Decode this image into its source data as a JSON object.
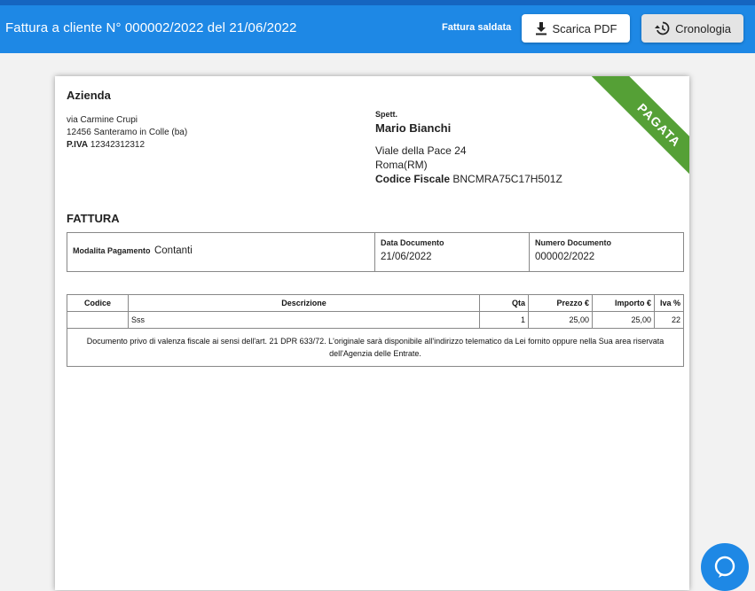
{
  "header": {
    "title": "Fattura a cliente N° 000002/2022 del 21/06/2022",
    "status": "Fattura saldata",
    "pdf_label": "Scarica PDF",
    "history_label": "Cronologia"
  },
  "invoice": {
    "stamp": "PAGATA",
    "company": {
      "name": "Azienda",
      "address1": "via Carmine Crupi",
      "address2": "12456 Santeramo in Colle (ba)",
      "piva_label": "P.IVA",
      "piva": "12342312312"
    },
    "client": {
      "prefix": "Spett.",
      "name": "Mario Bianchi",
      "address1": "Viale della Pace 24",
      "address2": "Roma(RM)",
      "cf_label": "Codice Fiscale",
      "cf": "BNCMRA75C17H501Z"
    },
    "doc_title": "FATTURA",
    "payment_label": "Modalita Pagamento",
    "payment_value": "Contanti",
    "date_label": "Data Documento",
    "date_value": "21/06/2022",
    "number_label": "Numero Documento",
    "number_value": "000002/2022",
    "table": {
      "headers": [
        "Codice",
        "Descrizione",
        "Qta",
        "Prezzo €",
        "Importo €",
        "Iva %"
      ],
      "rows": [
        [
          "",
          "Sss",
          "1",
          "25,00",
          "25,00",
          "22"
        ]
      ],
      "note": "Documento privo di valenza fiscale ai sensi dell'art. 21 DPR 633/72. L'originale sarà disponibile all'indirizzo telematico da Lei fornito oppure nella Sua area riservata dell'Agenzia delle Entrate."
    }
  },
  "icons": {
    "download": "download-icon",
    "history": "history-icon",
    "chat": "chat-icon"
  },
  "colors": {
    "appbar": "#1e88e5",
    "stamp": "#55a036"
  }
}
